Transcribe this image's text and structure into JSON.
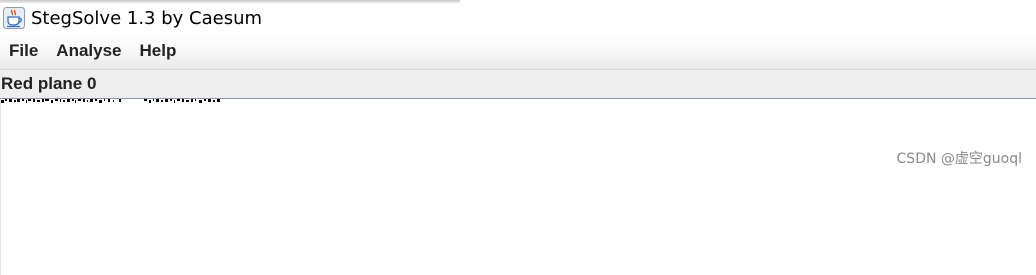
{
  "window": {
    "title": "StegSolve 1.3 by Caesum",
    "icon": "java-coffee-cup-icon"
  },
  "menubar": {
    "items": [
      {
        "label": "File"
      },
      {
        "label": "Analyse"
      },
      {
        "label": "Help"
      }
    ]
  },
  "panel": {
    "title": "Red plane 0"
  },
  "watermark": {
    "text": "CSDN @虚空guoql"
  },
  "colors": {
    "menubar_top": "#ffffff",
    "menubar_bottom": "#e8e8e8",
    "panel_header_bg": "#eeeeee",
    "panel_border": "#8a96a6",
    "pixel_color": "#000000",
    "watermark_color": "#8a8a8a"
  }
}
